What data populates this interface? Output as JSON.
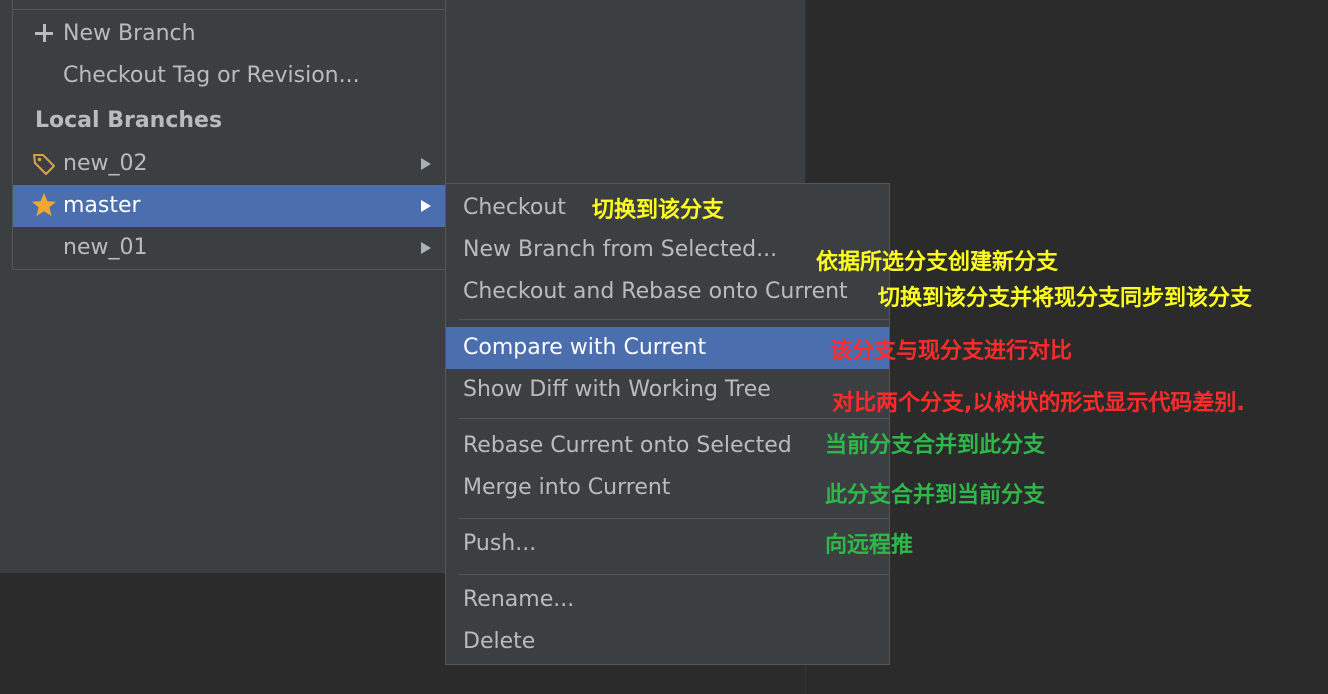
{
  "branch_popup": {
    "actions": [
      {
        "label": "New Branch",
        "icon": "plus-icon"
      },
      {
        "label": "Checkout Tag or Revision..."
      }
    ],
    "local_branches_header": "Local Branches",
    "branches": [
      {
        "label": "new_02",
        "icon": "tag-icon",
        "has_submenu": true,
        "selected": false
      },
      {
        "label": "master",
        "icon": "star-icon",
        "has_submenu": true,
        "selected": true
      },
      {
        "label": "new_01",
        "has_submenu": true,
        "selected": false
      }
    ]
  },
  "branch_submenu": {
    "items": [
      {
        "label": "Checkout"
      },
      {
        "label": "New Branch from Selected..."
      },
      {
        "label": "Checkout and Rebase onto Current"
      },
      {
        "label": "Compare with Current",
        "selected": true
      },
      {
        "label": "Show Diff with Working Tree"
      },
      {
        "label": "Rebase Current onto Selected"
      },
      {
        "label": "Merge into Current"
      },
      {
        "label": "Push..."
      },
      {
        "label": "Rename..."
      },
      {
        "label": "Delete"
      }
    ]
  },
  "annotations": [
    {
      "text": "切换到该分支",
      "color": "#ffff1e"
    },
    {
      "text": "依据所选分支创建新分支",
      "color": "#ffff1e"
    },
    {
      "text": "切换到该分支并将现分支同步到该分支",
      "color": "#ffff1e"
    },
    {
      "text": "该分支与现分支进行对比",
      "color": "#ff2b2b"
    },
    {
      "text": "对比两个分支,以树状的形式显示代码差别.",
      "color": "#ff2b2b"
    },
    {
      "text": "当前分支合并到此分支",
      "color": "#2fb84a"
    },
    {
      "text": "此分支合并到当前分支",
      "color": "#2fb84a"
    },
    {
      "text": "向远程推",
      "color": "#2fb84a"
    }
  ],
  "colors": {
    "panel_bg": "#3c3f41",
    "editor_bg": "#2b2b2b",
    "selection": "#4b6eaf",
    "text": "#bbbbbb",
    "star": "#f0a732",
    "tag": "#d9a343"
  }
}
